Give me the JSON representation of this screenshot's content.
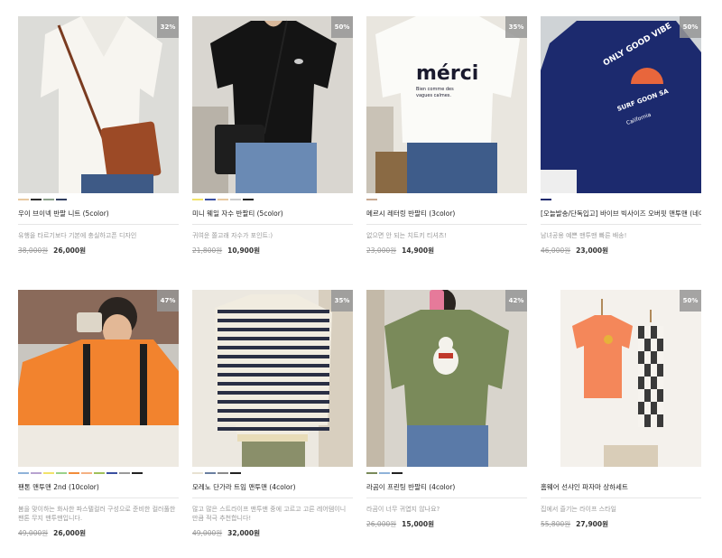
{
  "products": [
    {
      "name": "우이 브이넥 반팔 니트 (5color)",
      "discount": "32%",
      "description": "유행을 타르기보다 기본에 충실하고픈 디자인",
      "original_price": "38,000원",
      "sale_price": "26,000원",
      "colors": [
        "#e8c9a0",
        "#2b2b2b",
        "#8aa08a",
        "#2f3d5e"
      ],
      "image": "model-white-vneck-knit-brown-bag"
    },
    {
      "name": "미니 웨일 자수 반팔티 (5color)",
      "discount": "50%",
      "description": "귀여운 쫄고래 자수가 포인트:)",
      "original_price": "21,800원",
      "sale_price": "10,900원",
      "colors": [
        "#f2e36a",
        "#3a4fa0",
        "#e8c9a0",
        "#ffffff",
        "#222222"
      ],
      "image": "model-black-tee-shoulder-bag"
    },
    {
      "name": "메르시 레터링 반팔티 (3color)",
      "discount": "35%",
      "description": "없으면 안 되는 치트키 티셔츠!",
      "original_price": "23,000원",
      "sale_price": "14,900원",
      "colors": [
        "#c8a890"
      ],
      "image": "model-white-merci-tee"
    },
    {
      "name": "[오늘발송/단독입고] 바이브 빅사이즈 오버핏 맨투맨 (네이비)",
      "discount": "50%",
      "description": "남녀공용 예쁜 맨투맨 빠른 배송!",
      "original_price": "46,000원",
      "sale_price": "23,000원",
      "colors": [
        "#1f2a6e"
      ],
      "image": "model-navy-sweatshirt-back-print"
    },
    {
      "name": "팬톤 맨투맨 2nd (10color)",
      "discount": "47%",
      "description": "봄을 맞이하는 화사한 파스텔컬러 구성으로 준비한 컬러풀한 팬톤 무지 맨투맨입니다.",
      "original_price": "49,000원",
      "sale_price": "26,000원",
      "colors": [
        "#8fb3d9",
        "#b7a3d0",
        "#f2e36a",
        "#9ad18b",
        "#f28c3a",
        "#f4b183",
        "#a0c05a",
        "#3a4fa0",
        "#9a9a9a",
        "#222222"
      ],
      "image": "model-orange-sweatshirt-backpack"
    },
    {
      "name": "모레노 단가라 트임 맨투맨 (4color)",
      "discount": "35%",
      "description": "많고 많은 스트라이프 맨투맨 중에 고르고 고른 레어템이니 만큼 적극 추천합니다!",
      "original_price": "49,000원",
      "sale_price": "32,000원",
      "colors": [
        "#e8e2d2",
        "#6a7fa0",
        "#8a8a8a",
        "#222222"
      ],
      "image": "model-striped-sweatshirt"
    },
    {
      "name": "라곰이 프린팅 반팔티 (4color)",
      "discount": "42%",
      "description": "라곰이 너무 귀엽지 않나요?",
      "original_price": "26,000원",
      "sale_price": "15,000원",
      "colors": [
        "#7a8a5a",
        "#8fb3d9",
        "#222222"
      ],
      "image": "model-khaki-bear-print-tee"
    },
    {
      "name": "홈웨어 선샤인 파자마 상하세트",
      "discount": "50%",
      "description": "집에서 즐기는 라이프 스타일",
      "original_price": "55,800원",
      "sale_price": "27,900원",
      "colors": [],
      "image": "hanging-orange-pajama-set"
    }
  ]
}
